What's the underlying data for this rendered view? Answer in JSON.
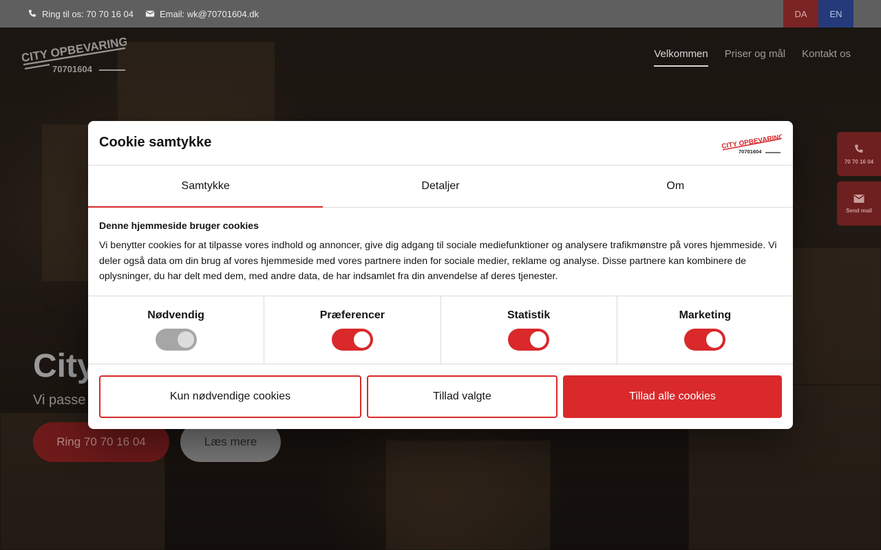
{
  "topbar": {
    "phone_text": "Ring til os: 70 70 16 04",
    "email_text": "Email: wk@70701604.dk",
    "languages": [
      "DA",
      "EN"
    ]
  },
  "logo": {
    "line1": "CITY OPBEVARING",
    "line2": "70701604"
  },
  "nav": {
    "items": [
      "Velkommen",
      "Priser og mål",
      "Kontakt os"
    ],
    "active": "Velkommen"
  },
  "hero": {
    "title_visible": "City",
    "subtitle_visible": "Vi passe",
    "call_button": "Ring 70 70 16 04",
    "more_button": "Læs mere"
  },
  "side_widgets": {
    "phone_label": "70 70 16 04",
    "mail_label": "Send mail"
  },
  "cookie_dialog": {
    "title": "Cookie samtykke",
    "tabs": [
      "Samtykke",
      "Detaljer",
      "Om"
    ],
    "active_tab": "Samtykke",
    "heading": "Denne hjemmeside bruger cookies",
    "paragraph": "Vi benytter cookies for at tilpasse vores indhold og annoncer, give dig adgang til sociale mediefunktioner og analysere trafikmønstre på vores hjemmeside. Vi deler også data om din brug af vores hjemmeside med vores partnere inden for sociale medier, reklame og analyse. Disse partnere kan kombinere de oplysninger, du har delt med dem, med andre data, de har indsamlet fra din anvendelse af deres tjenester.",
    "categories": [
      {
        "label": "Nødvendig",
        "state": "on-locked"
      },
      {
        "label": "Præferencer",
        "state": "on"
      },
      {
        "label": "Statistik",
        "state": "on"
      },
      {
        "label": "Marketing",
        "state": "on"
      }
    ],
    "buttons": {
      "necessary_only": "Kun nødvendige cookies",
      "allow_selected": "Tillad valgte",
      "allow_all": "Tillad alle cookies"
    }
  },
  "colors": {
    "accent": "#d9292b",
    "topbar": "#5f5f5f",
    "lang_da": "#7a2424",
    "lang_en": "#243a7a"
  }
}
